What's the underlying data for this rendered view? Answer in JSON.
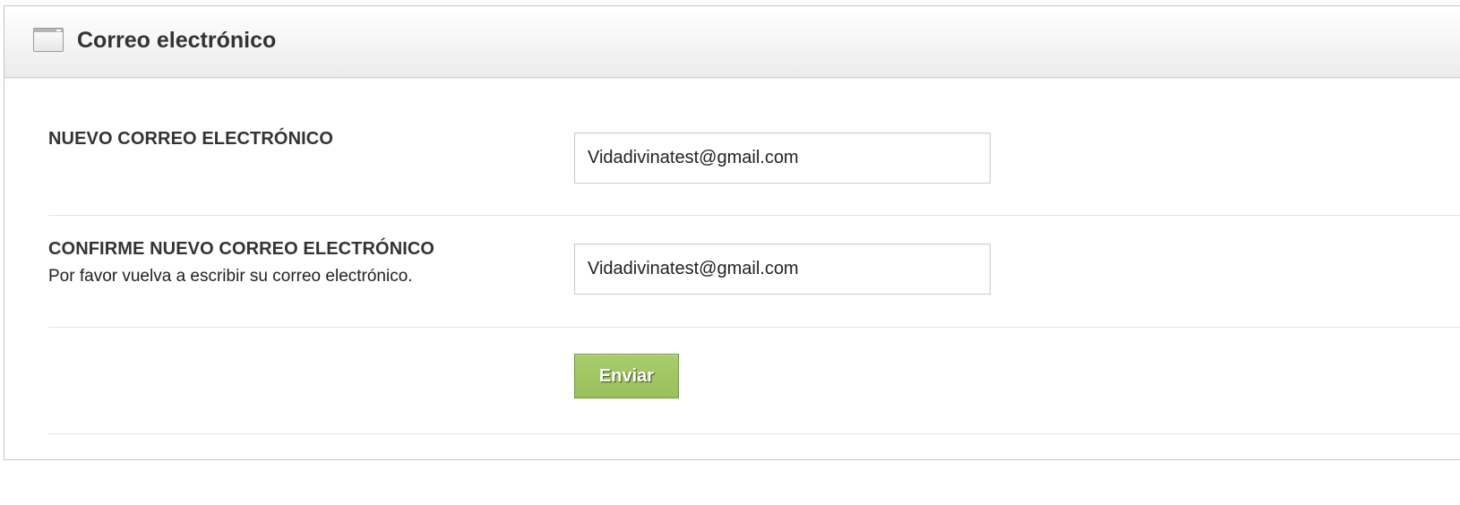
{
  "panel": {
    "title": "Correo electrónico",
    "icon": "window-icon"
  },
  "form": {
    "new_email": {
      "label": "NUEVO CORREO ELECTRÓNICO",
      "value": "Vidadivinatest@gmail.com"
    },
    "confirm_email": {
      "label": "CONFIRME NUEVO CORREO ELECTRÓNICO",
      "help": "Por favor vuelva a escribir su correo electrónico.",
      "value": "Vidadivinatest@gmail.com"
    },
    "submit_label": "Enviar"
  },
  "colors": {
    "button_green": "#9dc45f",
    "button_border": "#6e9a3a",
    "text_dark": "#333333"
  }
}
